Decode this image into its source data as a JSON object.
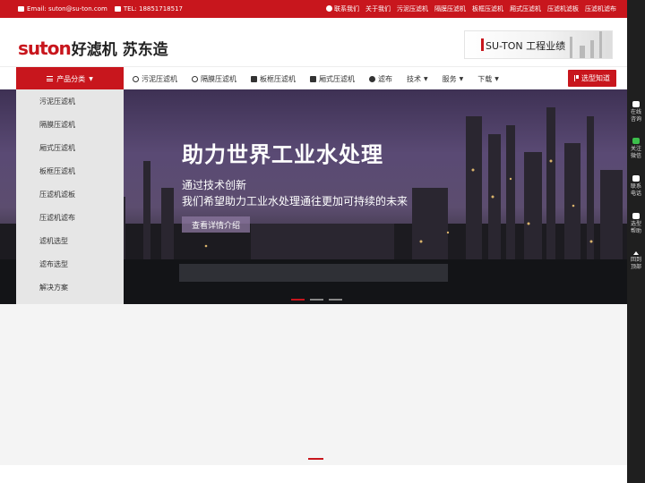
{
  "topbar": {
    "email": "Email: suton@su-ton.com",
    "tel": "TEL: 18851718517",
    "links": [
      "联系我们",
      "关于我们",
      "污泥压滤机",
      "隔膜压滤机",
      "板框压滤机",
      "厢式压滤机",
      "压滤机滤板",
      "压滤机滤布"
    ]
  },
  "header": {
    "brand": "suton",
    "slogan": "好滤机 苏东造",
    "banner_text": "SU-TON 工程业绩"
  },
  "nav": {
    "category_label": "产品分类",
    "items": [
      {
        "label": "污泥压滤机",
        "icon": "target-icon"
      },
      {
        "label": "隔膜压滤机",
        "icon": "at-icon"
      },
      {
        "label": "板框压滤机",
        "icon": "copy-icon"
      },
      {
        "label": "厢式压滤机",
        "icon": "database-icon"
      },
      {
        "label": "滤布",
        "icon": "x-circle-icon"
      },
      {
        "label": "技术",
        "dropdown": true
      },
      {
        "label": "服务",
        "dropdown": true
      },
      {
        "label": "下载",
        "dropdown": true
      }
    ],
    "select_button": "选型知道"
  },
  "dropdown": {
    "items": [
      "污泥压滤机",
      "隔膜压滤机",
      "厢式压滤机",
      "板框压滤机",
      "压滤机滤板",
      "压滤机滤布",
      "滤机选型",
      "滤布选型",
      "解决方案"
    ]
  },
  "hero": {
    "title": "助力世界工业水处理",
    "subtitle1": "通过技术创新",
    "subtitle2": "我们希望助力工业水处理通往更加可持续的未来",
    "button": "查看详情介绍",
    "slides": 3,
    "active_slide": 1
  },
  "sidebar": {
    "items": [
      {
        "l1": "在线",
        "l2": "咨询"
      },
      {
        "l1": "关注",
        "l2": "微信"
      },
      {
        "l1": "联系",
        "l2": "电话"
      },
      {
        "l1": "选型",
        "l2": "帮助"
      },
      {
        "l1": "回到",
        "l2": "顶部"
      }
    ]
  },
  "colors": {
    "accent": "#c8161d"
  }
}
